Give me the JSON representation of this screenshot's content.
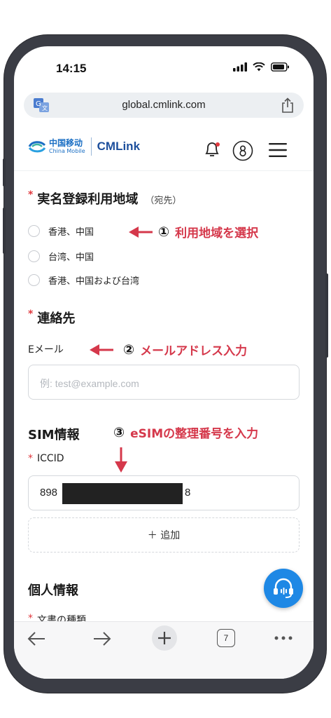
{
  "status": {
    "time": "14:15"
  },
  "browser": {
    "url": "global.cmlink.com",
    "tab_count": "7"
  },
  "site": {
    "logo_cn": "中国移动",
    "logo_en": "China Mobile",
    "logo_brand": "CMLink"
  },
  "region": {
    "title": "実名登録利用地域",
    "dest": "（宛先）",
    "required_mark": "*",
    "options": [
      "香港、中国",
      "台湾、中国",
      "香港、中国および台湾"
    ]
  },
  "contact": {
    "title": "連絡先",
    "required_mark": "*",
    "email_label": "Eメール",
    "email_placeholder": "例: test@example.com"
  },
  "sim": {
    "title": "SIM情報",
    "iccid_label": "ICCID",
    "required_mark": "*",
    "iccid_prefix": "898",
    "iccid_suffix": "8",
    "add_label": "＋ 追加"
  },
  "personal": {
    "title": "個人情報",
    "doc_type_label": "文書の種類",
    "required_mark": "*"
  },
  "annotations": {
    "a1_num": "①",
    "a1_text": "利用地域を選択",
    "a2_num": "②",
    "a2_text": "メールアドレス入力",
    "a3_num": "③",
    "a3_text": "eSIMの整理番号を入力"
  },
  "colors": {
    "annotation": "#d5384b",
    "required": "#e0393e",
    "fab": "#1e88e5",
    "brand": "#1d4f9c"
  }
}
